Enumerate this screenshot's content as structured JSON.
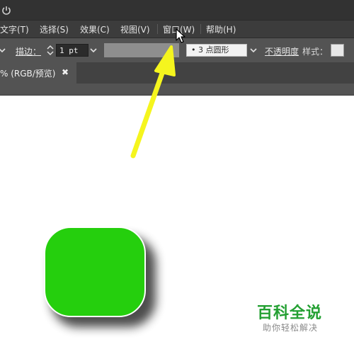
{
  "menubar": {
    "items": [
      "文字(T)",
      "选择(S)",
      "效果(C)",
      "视图(V)",
      "窗口(W)",
      "帮助(H)"
    ]
  },
  "controlbar": {
    "stroke_label": "描边：",
    "stroke_value": "1 pt",
    "brush_value": "• 3 点圆形",
    "opacity_label": "不透明度",
    "style_label": "样式："
  },
  "tab": {
    "label": "% (RGB/预览)",
    "close": "✖"
  },
  "canvas": {
    "shape_fill": "#25cf0d"
  },
  "annotation": {
    "arrow_color": "#f5f51e"
  },
  "watermark": {
    "title": "百科全说",
    "subtitle": "助你轻松解决"
  }
}
